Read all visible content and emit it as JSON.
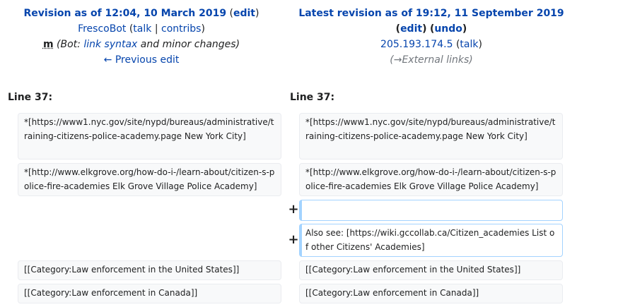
{
  "left_header": {
    "title": "Revision as of 12:04, 10 March 2019",
    "edit": "edit",
    "user": "FrescoBot",
    "talk": "talk",
    "contribs": "contribs",
    "minor": "m",
    "summary_prefix": "Bot:",
    "summary_link": "link syntax",
    "summary_suffix": "and minor changes",
    "prev_edit": "← Previous edit"
  },
  "right_header": {
    "title": "Latest revision as of 19:12, 11 September 2019",
    "edit": "edit",
    "undo": "undo",
    "user": "205.193.174.5",
    "talk": "talk",
    "autocomment_arrow": "→",
    "autocomment": "External links"
  },
  "diff": {
    "left_line": "Line 37:",
    "right_line": "Line 37:",
    "added_marker": "+",
    "rows": [
      {
        "left": "*[https://www1.nyc.gov/site/nypd/bureaus/administrative/training-citizens-police-academy.page New York City]",
        "right": "*[https://www1.nyc.gov/site/nypd/bureaus/administrative/training-citizens-police-academy.page New York City]"
      },
      {
        "left": "*[http://www.elkgrove.org/how-do-i-/learn-about/citizen-s-police-fire-academies Elk Grove Village Police Academy]",
        "right": "*[http://www.elkgrove.org/how-do-i-/learn-about/citizen-s-police-fire-academies Elk Grove Village Police Academy]"
      },
      {
        "left": "",
        "right": ""
      },
      {
        "left": "",
        "right": "Also see: [https://wiki.gccollab.ca/Citizen_academies List of other Citizens' Academies]"
      },
      {
        "left": "[[Category:Law enforcement in the United States]]",
        "right": "[[Category:Law enforcement in the United States]]"
      },
      {
        "left": "[[Category:Law enforcement in Canada]]",
        "right": "[[Category:Law enforcement in Canada]]"
      }
    ]
  }
}
